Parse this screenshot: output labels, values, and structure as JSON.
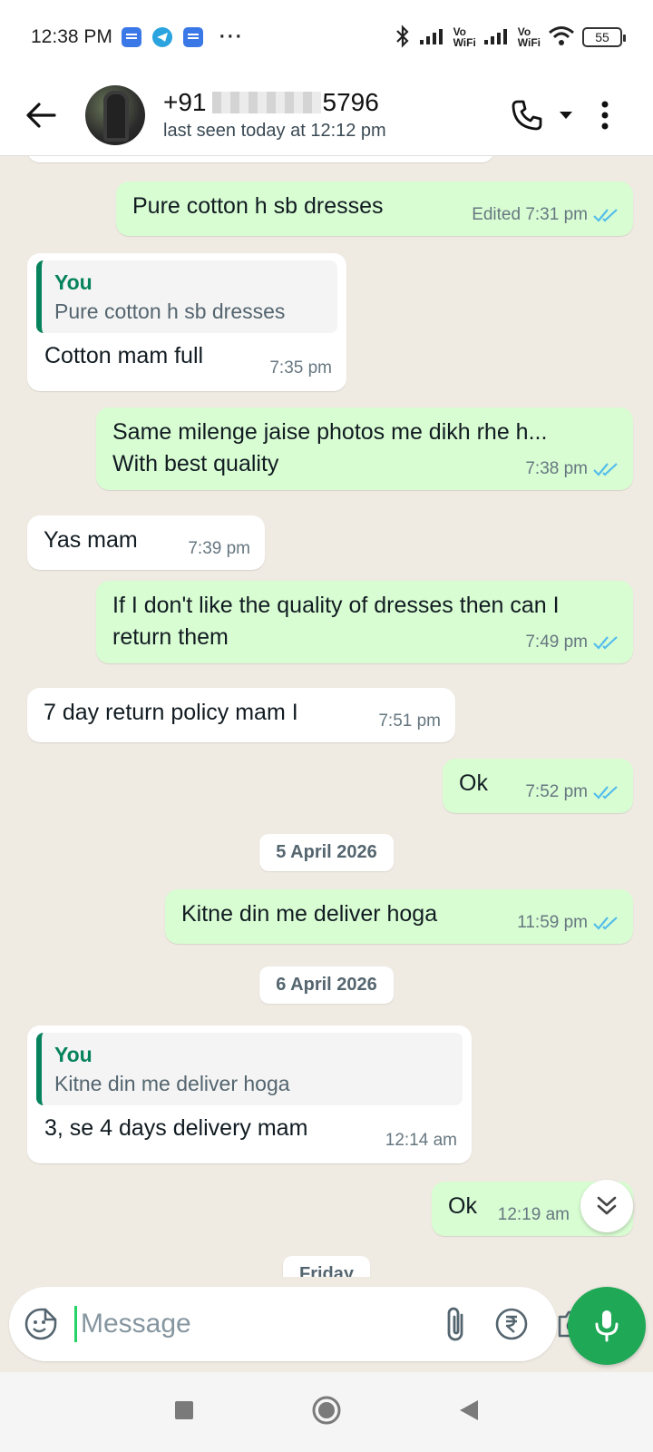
{
  "status_bar": {
    "time": "12:38 PM",
    "dots": "···",
    "vo1": "Vo",
    "wifi1": "WiFi",
    "vo2": "Vo",
    "wifi2": "WiFi",
    "battery": "55"
  },
  "header": {
    "name_prefix": "+91",
    "name_suffix": "5796",
    "last_seen": "last seen today at 12:12 pm"
  },
  "messages": [
    {
      "dir": "out",
      "text": "Pure cotton h sb dresses",
      "time": "Edited 7:31 pm",
      "ticks": true
    },
    {
      "dir": "in",
      "quote_name": "You",
      "quote_text": "Pure cotton h sb dresses",
      "text": "Cotton mam full",
      "time": "7:35 pm"
    },
    {
      "dir": "out",
      "text": "Same milenge jaise photos me dikh rhe h... With best quality",
      "time": "7:38 pm",
      "ticks": true
    },
    {
      "dir": "in",
      "text": "Yas mam",
      "time": "7:39 pm"
    },
    {
      "dir": "out",
      "text": "If I don't like the quality of dresses then can I return them",
      "time": "7:49 pm",
      "ticks": true
    },
    {
      "dir": "in",
      "text": "7 day return policy mam I",
      "time": "7:51 pm"
    },
    {
      "dir": "out",
      "text": "Ok",
      "time": "7:52 pm",
      "ticks": true
    },
    {
      "dir": "out",
      "text": "Kitne din me deliver hoga",
      "time": "11:59 pm",
      "ticks": true
    },
    {
      "dir": "in",
      "quote_name": "You",
      "quote_text": "Kitne din me deliver hoga",
      "text": "3, se 4 days delivery mam",
      "time": "12:14 am"
    },
    {
      "dir": "out",
      "text": "Ok",
      "time": "12:19 am",
      "ticks": true
    }
  ],
  "dates": {
    "d1": "5 April 2026",
    "d2": "6 April 2026",
    "d3": "Friday"
  },
  "input": {
    "placeholder": "Message"
  },
  "colors": {
    "outgoing_bubble": "#d9fdd3",
    "incoming_bubble": "#ffffff",
    "accent": "#1fa855",
    "tick_read": "#53bdeb",
    "chat_bg": "#efeae2"
  }
}
